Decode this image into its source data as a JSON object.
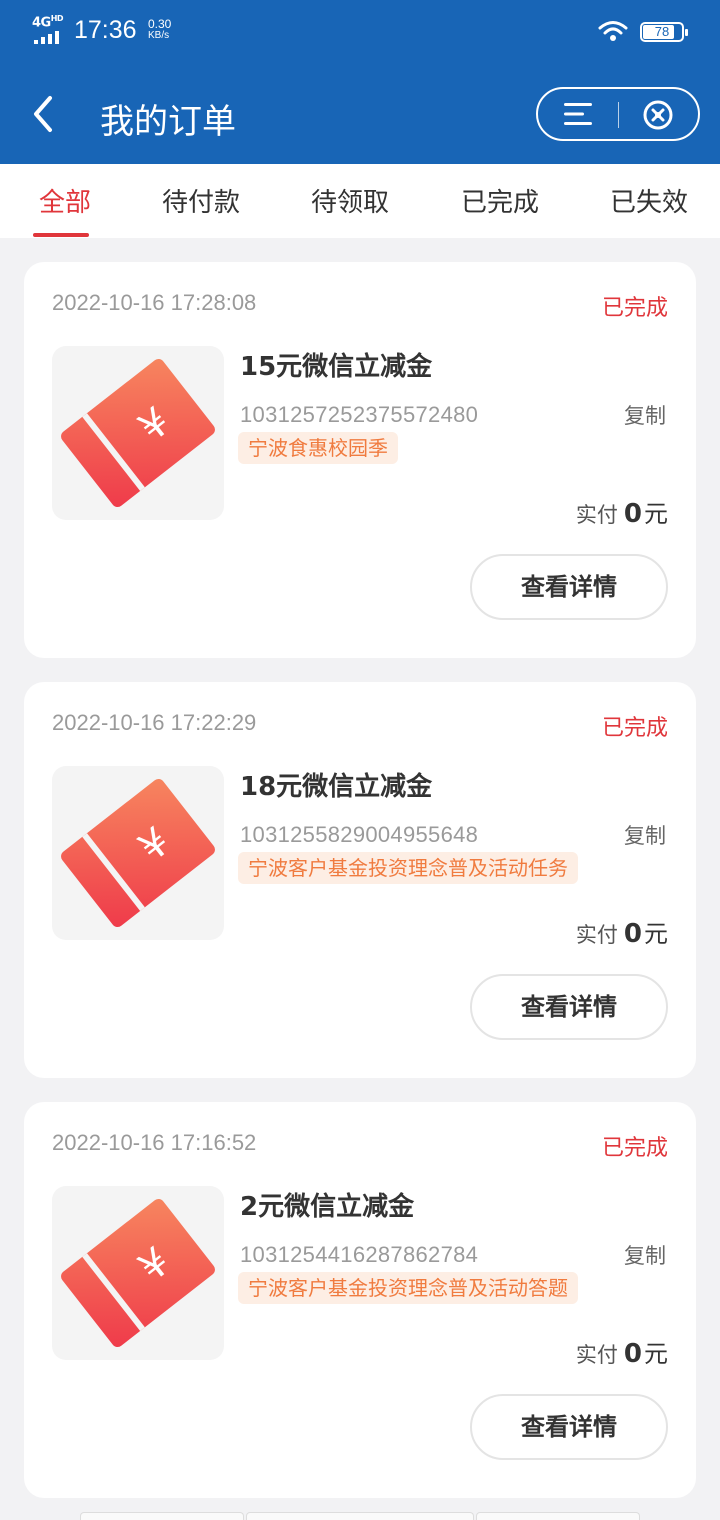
{
  "status_bar": {
    "network": "4G",
    "network_sup": "HD",
    "time": "17:36",
    "speed_value": "0.30",
    "speed_unit": "KB/s",
    "battery": "78"
  },
  "header": {
    "title": "我的订单"
  },
  "tabs": [
    {
      "label": "全部",
      "active": true
    },
    {
      "label": "待付款",
      "active": false
    },
    {
      "label": "待领取",
      "active": false
    },
    {
      "label": "已完成",
      "active": false
    },
    {
      "label": "已失效",
      "active": false
    }
  ],
  "orders": [
    {
      "time": "2022-10-16 17:28:08",
      "status": "已完成",
      "name": "15元微信立减金",
      "order_no": "1031257252375572480",
      "copy_label": "复制",
      "tag": "宁波食惠校园季",
      "paid_label": "实付",
      "paid_amount": "0",
      "paid_unit": "元",
      "detail_label": "查看详情"
    },
    {
      "time": "2022-10-16 17:22:29",
      "status": "已完成",
      "name": "18元微信立减金",
      "order_no": "1031255829004955648",
      "copy_label": "复制",
      "tag": "宁波客户基金投资理念普及活动任务",
      "paid_label": "实付",
      "paid_amount": "0",
      "paid_unit": "元",
      "detail_label": "查看详情"
    },
    {
      "time": "2022-10-16 17:16:52",
      "status": "已完成",
      "name": "2元微信立减金",
      "order_no": "1031254416287862784",
      "copy_label": "复制",
      "tag": "宁波客户基金投资理念普及活动答题",
      "paid_label": "实付",
      "paid_amount": "0",
      "paid_unit": "元",
      "detail_label": "查看详情"
    }
  ],
  "colors": {
    "header_bg": "#1865b6",
    "accent_red": "#e0363b",
    "tag_bg": "#fdeee4",
    "tag_text": "#f07b3f"
  },
  "icons": {
    "back": "chevron-left-icon",
    "menu": "menu-icon",
    "close": "close-circle-icon",
    "coupon": "coupon-ticket-icon"
  }
}
